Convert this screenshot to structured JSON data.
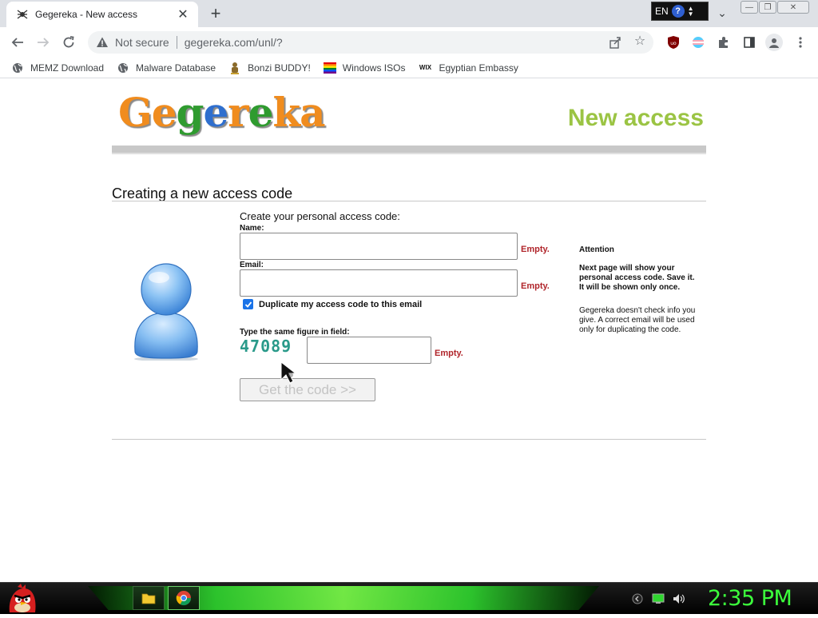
{
  "browser": {
    "tab_title": "Gegereka - New access",
    "lang": "EN",
    "help": "?",
    "security_label": "Not secure",
    "url": "gegereka.com/unl/?",
    "bookmarks": [
      {
        "label": "MEMZ Download",
        "icon": "globe-icon"
      },
      {
        "label": "Malware Database",
        "icon": "globe-icon"
      },
      {
        "label": "Bonzi BUDDY!",
        "icon": "bonzi-icon"
      },
      {
        "label": "Windows ISOs",
        "icon": "rainbow-flag-icon"
      },
      {
        "label": "Egyptian Embassy",
        "icon": "wix-icon",
        "icon_text": "WIX"
      }
    ]
  },
  "page": {
    "logo_letters": [
      "G",
      "e",
      "g",
      "e",
      "r",
      "e",
      "ka"
    ],
    "header_title": "New access",
    "section_title": "Creating a new access code",
    "form": {
      "intro": "Create your personal access code:",
      "name_label": "Name:",
      "email_label": "Email:",
      "empty_text": "Empty.",
      "duplicate_label": "Duplicate my access code to this email",
      "duplicate_checked": true,
      "captcha_label": "Type the same figure in field:",
      "captcha_value": "47089",
      "submit_label": "Get the code >>"
    },
    "attention": {
      "title": "Attention",
      "warning": "Next page will show your personal access code. Save it. It will be shown only once.",
      "info": "Gegereka doesn't check info you give. A correct email will be used only for duplicating the code."
    }
  },
  "taskbar": {
    "clock": "2:35 PM"
  },
  "colors": {
    "header_green": "#9bc444",
    "empty_red": "#b0242a",
    "clock_green": "#3cff3c"
  }
}
